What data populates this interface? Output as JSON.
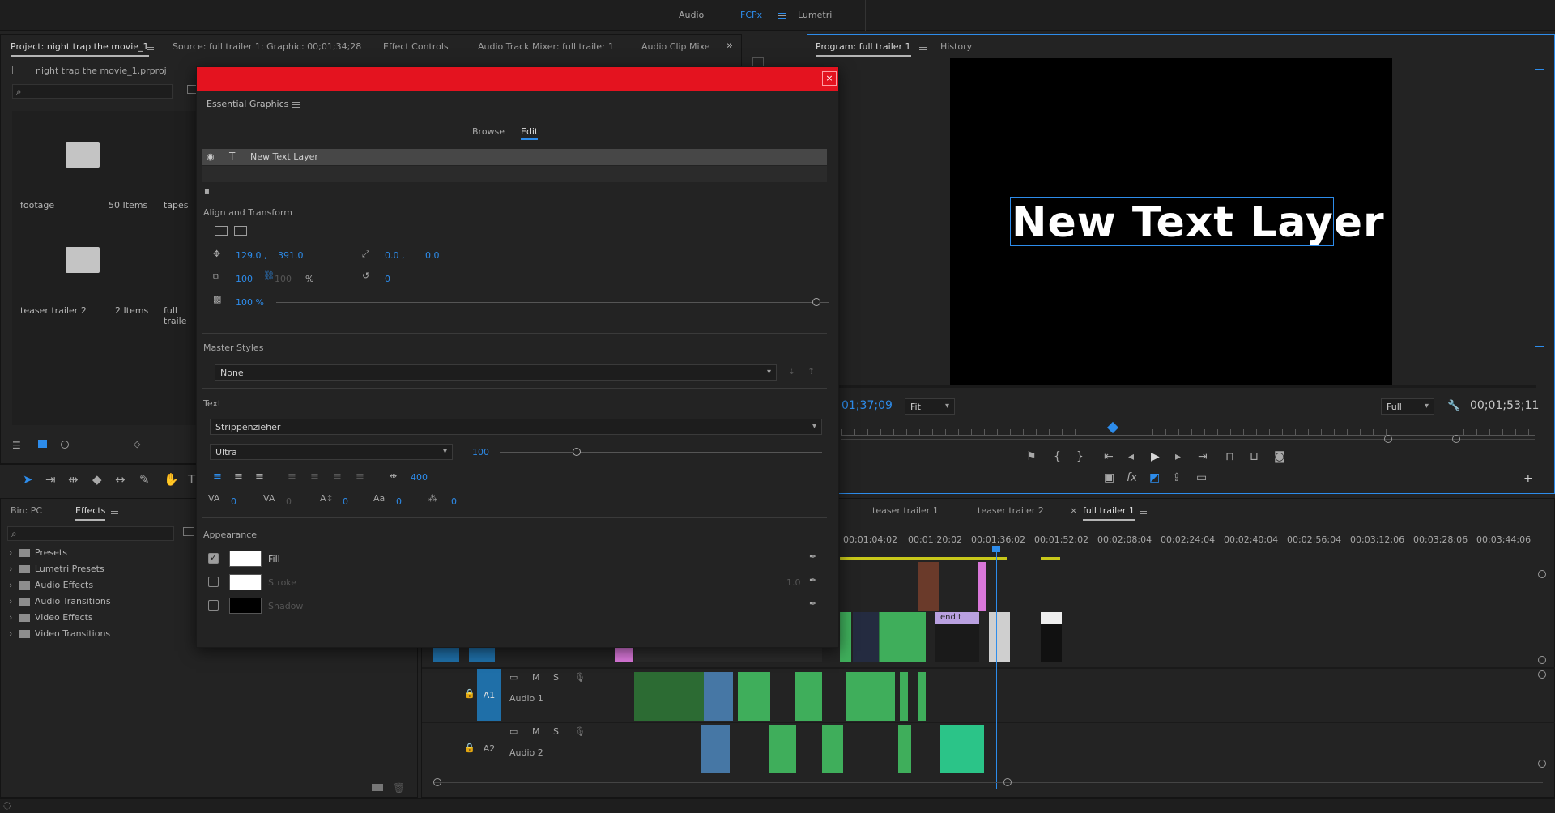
{
  "workspaces": {
    "items": [
      "Audio",
      "FCPx",
      "Lumetri"
    ],
    "active": "FCPx"
  },
  "project_panel": {
    "tabs": [
      "Project: night trap the movie_1",
      "Source: full trailer 1: Graphic: 00;01;34;28",
      "Effect Controls",
      "Audio Track Mixer: full trailer 1",
      "Audio Clip Mixe"
    ],
    "file_name": "night trap the movie_1.prproj",
    "bins": [
      {
        "name": "footage",
        "count": "50 Items"
      },
      {
        "name": "tapes",
        "count": ""
      },
      {
        "name": "teaser trailer 2",
        "count": "2 Items"
      },
      {
        "name": "full traile",
        "count": ""
      }
    ]
  },
  "program_monitor": {
    "tabs": [
      "Program: full trailer 1",
      "History"
    ],
    "overlay_text": "New Text Layer",
    "timecode_left": "01;37;09",
    "fit_option": "Fit",
    "quality_option": "Full",
    "timecode_right": "00;01;53;11"
  },
  "effects_panel": {
    "tabs": [
      "Bin: PC",
      "Effects"
    ],
    "items": [
      "Presets",
      "Lumetri Presets",
      "Audio Effects",
      "Audio Transitions",
      "Video Effects",
      "Video Transitions"
    ]
  },
  "timeline": {
    "sequence_tabs": [
      "teaser trailer 1",
      "teaser trailer 2",
      "full trailer 1"
    ],
    "active_sequence": "full trailer 1",
    "ruler_labels": [
      "00;01;04;02",
      "00;01;20;02",
      "00;01;36;02",
      "00;01;52;02",
      "00;02;08;04",
      "00;02;24;04",
      "00;02;40;04",
      "00;02;56;04",
      "00;03;12;06",
      "00;03;28;06",
      "00;03;44;06"
    ],
    "audio_tracks": [
      {
        "id": "A1",
        "name": "Audio 1",
        "m": "M",
        "s": "S"
      },
      {
        "id": "A2",
        "name": "Audio 2",
        "m": "M",
        "s": "S"
      }
    ],
    "clip_label": "end t"
  },
  "essential_graphics": {
    "title": "Essential Graphics",
    "tabs": [
      "Browse",
      "Edit"
    ],
    "active_tab": "Edit",
    "layer_name": "New Text Layer",
    "align_transform": {
      "heading": "Align and Transform",
      "pos_x": "129.0 ,",
      "pos_y": "391.0",
      "anchor_x": "0.0 ,",
      "anchor_y": "0.0",
      "scale": "100",
      "scale_h": "100",
      "scale_unit": "%",
      "rotation": "0",
      "opacity": "100 %"
    },
    "master_styles": {
      "heading": "Master Styles",
      "value": "None"
    },
    "text": {
      "heading": "Text",
      "font": "Strippenzieher",
      "style": "Ultra",
      "size": "100",
      "tracking": "400",
      "kerning": "0",
      "baseline": "0",
      "leading": "0",
      "tsume": "0",
      "extra": "0"
    },
    "appearance": {
      "heading": "Appearance",
      "fill_label": "Fill",
      "stroke_label": "Stroke",
      "stroke_width": "1.0",
      "shadow_label": "Shadow",
      "fill_color": "#ffffff",
      "stroke_color": "#ffffff",
      "shadow_color": "#000000"
    }
  },
  "colors": {
    "accent": "#2d8ceb",
    "titlebar": "#e4131f",
    "clip_green": "#3fae5b",
    "clip_pink": "#d977d9",
    "track_blue": "#1f6fa8"
  }
}
